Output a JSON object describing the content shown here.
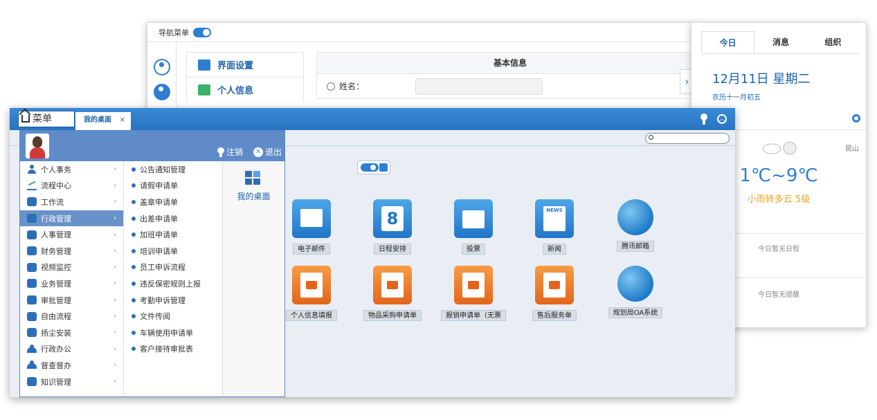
{
  "settings": {
    "nav_label": "导航菜单",
    "menu": [
      "界面设置",
      "个人信息"
    ],
    "info_title": "基本信息",
    "name_label": "姓名："
  },
  "today": {
    "tabs": [
      "今日",
      "消息",
      "组织"
    ],
    "date": "12月11日 星期二",
    "lunar": "农历十一月初五",
    "city": "昆山",
    "temperature": "1℃~9℃",
    "condition": "小雨转多云 5级",
    "no_schedule": "今日暂无日程",
    "no_reminder": "今日暂无提醒",
    "arrow": "›"
  },
  "desk": {
    "menu_label": "菜单",
    "tab_label": "我的桌面",
    "tab_close": "×",
    "start_menu": {
      "logout": "注销",
      "exit": "退出",
      "exit_glyph": "✕",
      "categories": [
        {
          "label": "个人事务",
          "icon": "person"
        },
        {
          "label": "流程中心",
          "icon": "flow"
        },
        {
          "label": "工作流",
          "icon": "box"
        },
        {
          "label": "行政管理",
          "icon": "box"
        },
        {
          "label": "人事管理",
          "icon": "box"
        },
        {
          "label": "财务管理",
          "icon": "box"
        },
        {
          "label": "视频监控",
          "icon": "box"
        },
        {
          "label": "业务管理",
          "icon": "box"
        },
        {
          "label": "审批管理",
          "icon": "box"
        },
        {
          "label": "自由流程",
          "icon": "box"
        },
        {
          "label": "扬尘安装",
          "icon": "box"
        },
        {
          "label": "行政办公",
          "icon": "group"
        },
        {
          "label": "督查督办",
          "icon": "group"
        },
        {
          "label": "知识管理",
          "icon": "box"
        }
      ],
      "active_category": 3,
      "subitems": [
        "公告通知管理",
        "请假申请单",
        "盖章申请单",
        "出差申请单",
        "加班申请单",
        "培训申请单",
        "员工申诉流程",
        "违反保密规则上报",
        "考勤申诉管理",
        "文件传阅",
        "车辆使用申请单",
        "客户接待审批表"
      ],
      "desktop_label": "我的桌面"
    },
    "apps_row1": [
      {
        "label": "电子邮件",
        "icon": "mail-icon"
      },
      {
        "label": "日程安排",
        "icon": "calendar-icon",
        "glyph": "8"
      },
      {
        "label": "投票",
        "icon": "vote-icon"
      },
      {
        "label": "新闻",
        "icon": "news-icon",
        "glyph": "NEWS"
      },
      {
        "label": "腾讯邮箱",
        "icon": "globe-icon"
      }
    ],
    "apps_row2": [
      {
        "label": "个人信息填报",
        "icon": "form-icon"
      },
      {
        "label": "物品采购申请单",
        "icon": "form-icon"
      },
      {
        "label": "报销申请单（无票",
        "icon": "form-icon"
      },
      {
        "label": "售后服务单",
        "icon": "form-icon"
      },
      {
        "label": "规划局OA系统",
        "icon": "globe-icon"
      }
    ]
  }
}
